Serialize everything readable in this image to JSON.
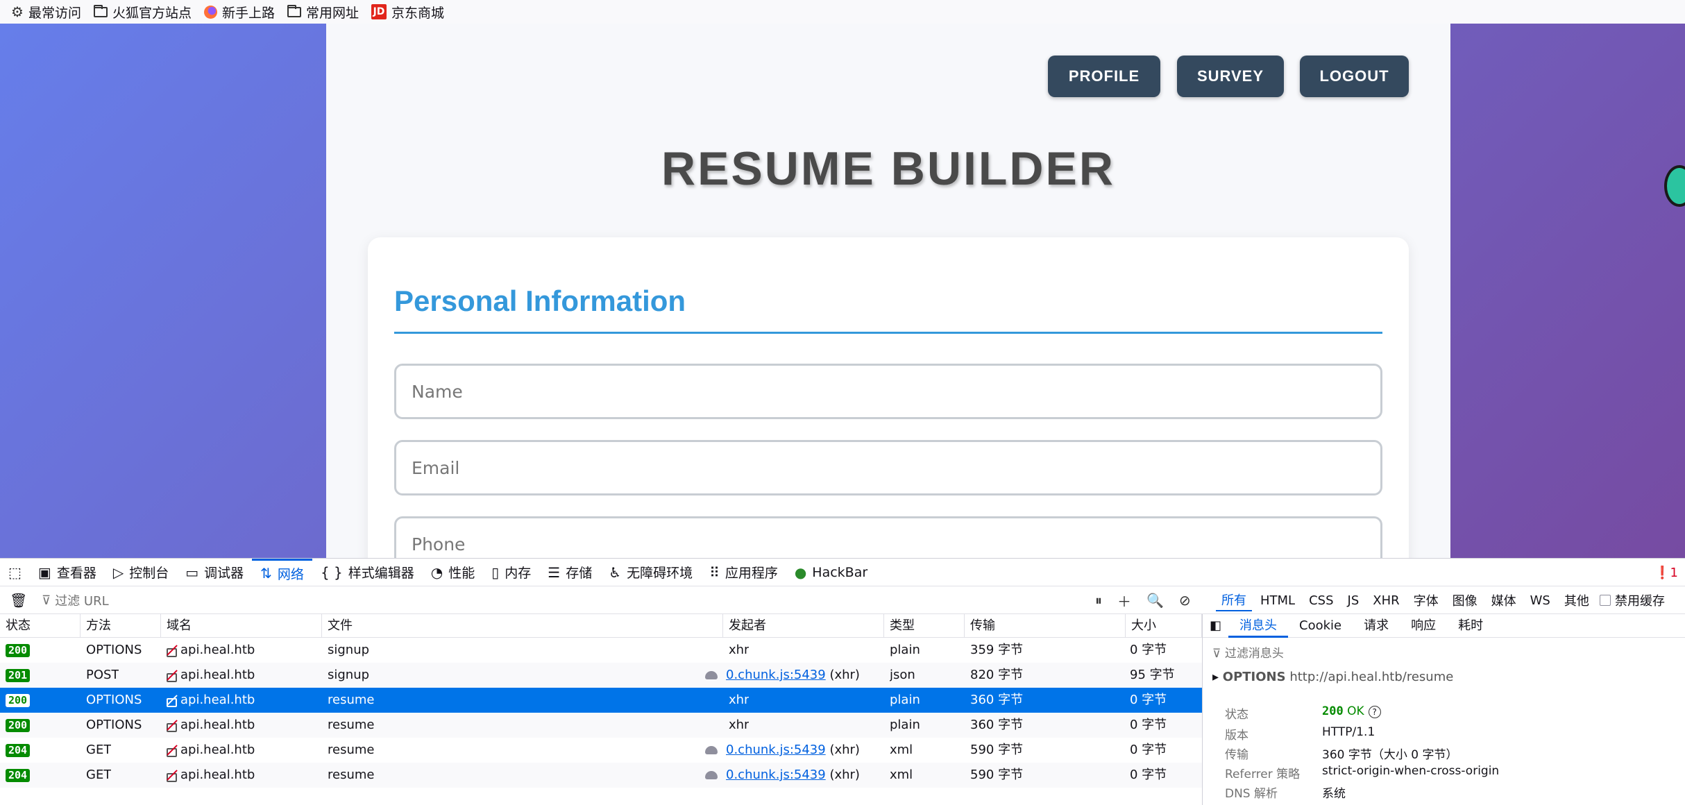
{
  "bookmarks": {
    "items": [
      "最常访问",
      "火狐官方站点",
      "新手上路",
      "常用网址",
      "京东商城"
    ]
  },
  "page": {
    "nav": {
      "profile": "PROFILE",
      "survey": "SURVEY",
      "logout": "LOGOUT"
    },
    "title": "RESUME BUILDER",
    "section_title": "Personal Information",
    "fields": {
      "name_placeholder": "Name",
      "email_placeholder": "Email",
      "phone_placeholder": "Phone"
    },
    "colors": {
      "accent": "#3498db",
      "nav_button": "#34495e",
      "bg_start": "#667eea",
      "bg_end": "#764ba2"
    }
  },
  "devtools": {
    "tabs": [
      "查看器",
      "控制台",
      "调试器",
      "网络",
      "样式编辑器",
      "性能",
      "内存",
      "存储",
      "无障碍环境",
      "应用程序",
      "HackBar"
    ],
    "active_tab": "网络",
    "error_count": "1",
    "filter_placeholder": "过滤 URL",
    "type_filters": [
      "所有",
      "HTML",
      "CSS",
      "JS",
      "XHR",
      "字体",
      "图像",
      "媒体",
      "WS",
      "其他"
    ],
    "disable_cache": "禁用缓存",
    "columns": [
      "状态",
      "方法",
      "域名",
      "文件",
      "发起者",
      "类型",
      "传输",
      "大小"
    ],
    "requests": [
      {
        "status": "200",
        "method": "OPTIONS",
        "domain": "api.heal.htb",
        "file": "signup",
        "initiator": "xhr",
        "initiator_link": "",
        "type": "plain",
        "transferred": "359 字节",
        "size": "0 字节"
      },
      {
        "status": "201",
        "method": "POST",
        "domain": "api.heal.htb",
        "file": "signup",
        "initiator": "(xhr)",
        "initiator_link": "0.chunk.js:5439",
        "type": "json",
        "transferred": "820 字节",
        "size": "95 字节"
      },
      {
        "status": "200",
        "method": "OPTIONS",
        "domain": "api.heal.htb",
        "file": "resume",
        "initiator": "xhr",
        "initiator_link": "",
        "type": "plain",
        "transferred": "360 字节",
        "size": "0 字节"
      },
      {
        "status": "200",
        "method": "OPTIONS",
        "domain": "api.heal.htb",
        "file": "resume",
        "initiator": "xhr",
        "initiator_link": "",
        "type": "plain",
        "transferred": "360 字节",
        "size": "0 字节"
      },
      {
        "status": "204",
        "method": "GET",
        "domain": "api.heal.htb",
        "file": "resume",
        "initiator": "(xhr)",
        "initiator_link": "0.chunk.js:5439",
        "type": "xml",
        "transferred": "590 字节",
        "size": "0 字节"
      },
      {
        "status": "204",
        "method": "GET",
        "domain": "api.heal.htb",
        "file": "resume",
        "initiator": "(xhr)",
        "initiator_link": "0.chunk.js:5439",
        "type": "xml",
        "transferred": "590 字节",
        "size": "0 字节"
      }
    ],
    "detail": {
      "tabs": [
        "消息头",
        "Cookie",
        "请求",
        "响应",
        "耗时"
      ],
      "filter_placeholder": "过滤消息头",
      "method": "OPTIONS",
      "url": "http://api.heal.htb/resume",
      "status_label": "状态",
      "status_code": "200",
      "status_text": "OK",
      "version_label": "版本",
      "version": "HTTP/1.1",
      "transfer_label": "传输",
      "transfer": "360 字节（大小 0 字节）",
      "referrer_label": "Referrer 策略",
      "referrer": "strict-origin-when-cross-origin",
      "dns_label": "DNS 解析",
      "dns": "系统"
    }
  }
}
